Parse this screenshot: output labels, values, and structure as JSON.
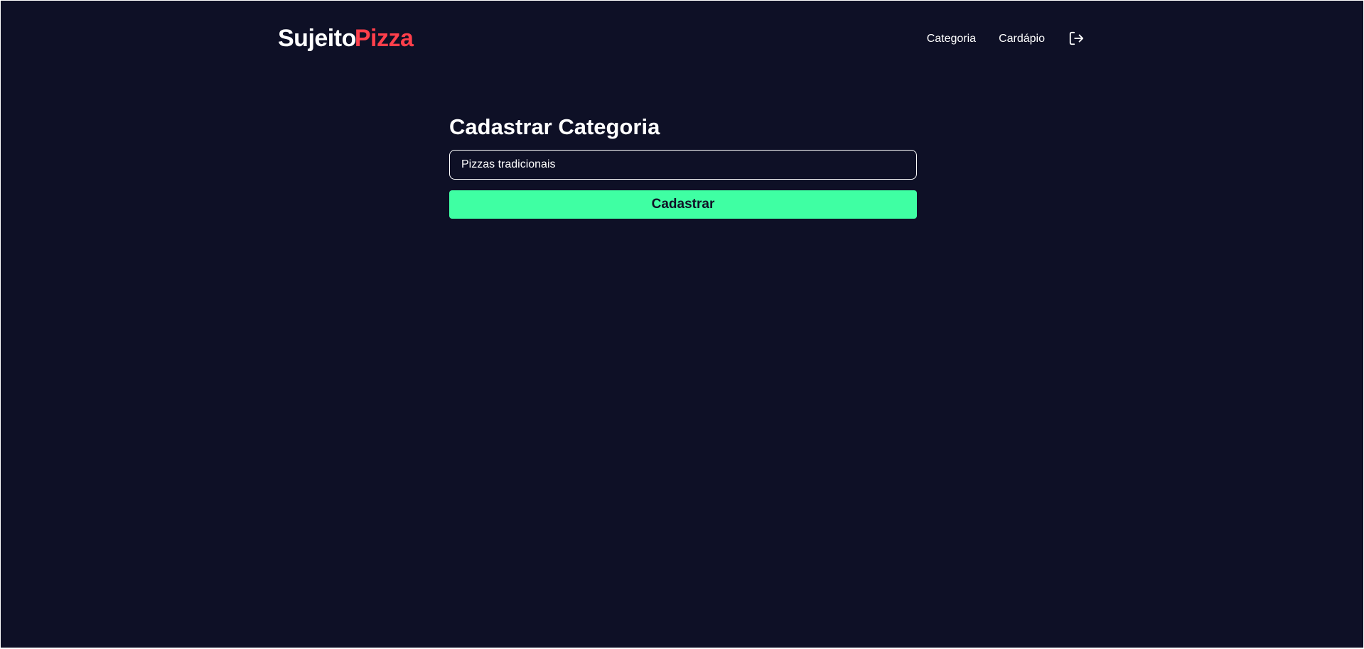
{
  "header": {
    "logo": {
      "part1": "Sujeito",
      "part2": "Pizza"
    },
    "nav": [
      {
        "label": "Categoria"
      },
      {
        "label": "Cardápio"
      }
    ],
    "logout_icon": "logout-icon"
  },
  "main": {
    "title": "Cadastrar Categoria",
    "input": {
      "value": "Pizzas tradicionais",
      "placeholder": ""
    },
    "submit_label": "Cadastrar"
  },
  "colors": {
    "background": "#0e1026",
    "accent_red": "#ff3f4b",
    "accent_green": "#3fffa3",
    "text": "#ffffff"
  }
}
